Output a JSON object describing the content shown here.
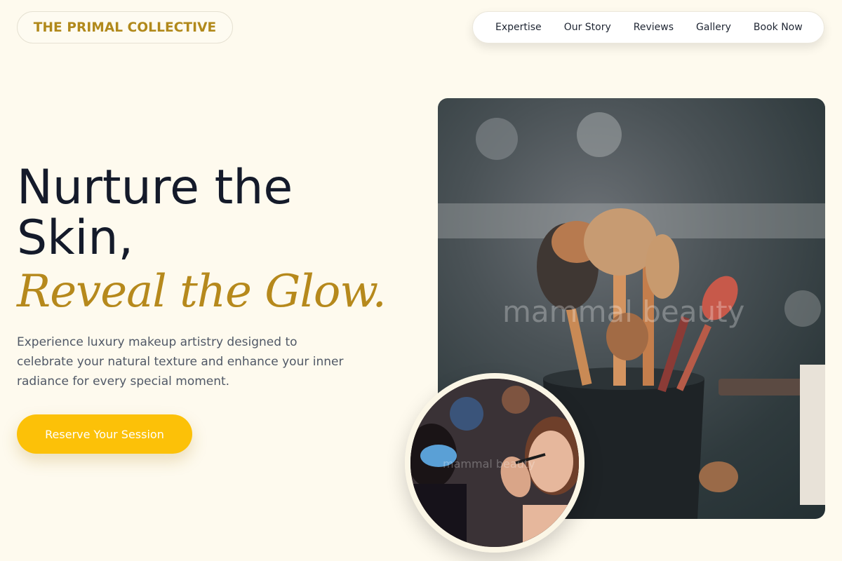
{
  "brand": {
    "name": "THE PRIMAL COLLECTIVE"
  },
  "nav": {
    "items": [
      {
        "label": "Expertise"
      },
      {
        "label": "Our Story"
      },
      {
        "label": "Reviews"
      },
      {
        "label": "Gallery"
      },
      {
        "label": "Book Now"
      }
    ]
  },
  "hero": {
    "headline_line1": "Nurture the",
    "headline_line2": "Skin,",
    "headline_accent": "Reveal the Glow.",
    "lead": "Experience luxury makeup artistry designed to celebrate your natural texture and enhance your inner radiance for every special moment.",
    "cta_label": "Reserve Your Session"
  },
  "images": {
    "main_watermark": "mammal beauty",
    "circle_watermark": "mammal beauty"
  },
  "colors": {
    "background": "#fefaee",
    "brand_gold": "#b1891b",
    "accent_gold": "#b6891c",
    "cta_yellow": "#fcc108",
    "headline": "#141a2a"
  }
}
